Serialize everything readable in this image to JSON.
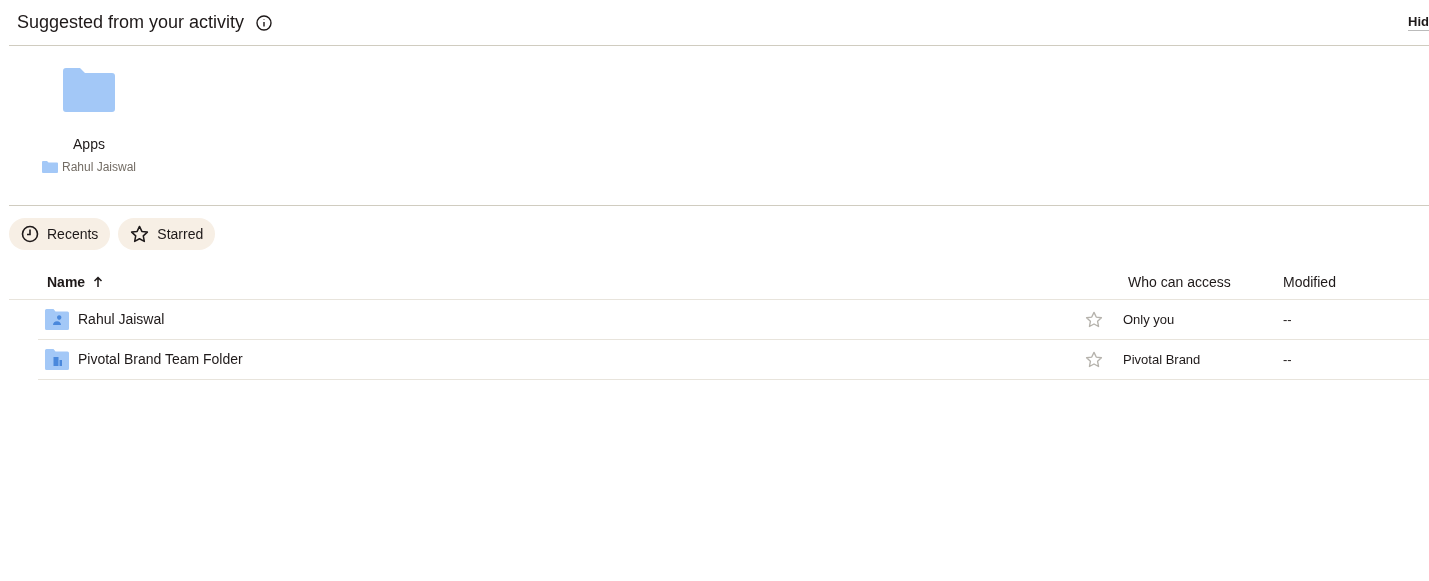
{
  "suggested": {
    "title": "Suggested from your activity",
    "hide_link": "Hid",
    "items": [
      {
        "name": "Apps",
        "location": "Rahul Jaiswal"
      }
    ]
  },
  "filters": [
    {
      "label": "Recents",
      "kind": "recents"
    },
    {
      "label": "Starred",
      "kind": "starred"
    }
  ],
  "table": {
    "columns": [
      {
        "label": "Name",
        "sort_descending": false
      },
      {
        "label": "Who can access"
      },
      {
        "label": "Modified"
      }
    ],
    "rows": [
      {
        "name": "Rahul Jaiswal",
        "kind": "personal",
        "starred": false,
        "access": "Only you",
        "modified": "--"
      },
      {
        "name": "Pivotal Brand Team Folder",
        "kind": "team",
        "starred": false,
        "access": "Pivotal Brand",
        "modified": "--"
      }
    ]
  }
}
